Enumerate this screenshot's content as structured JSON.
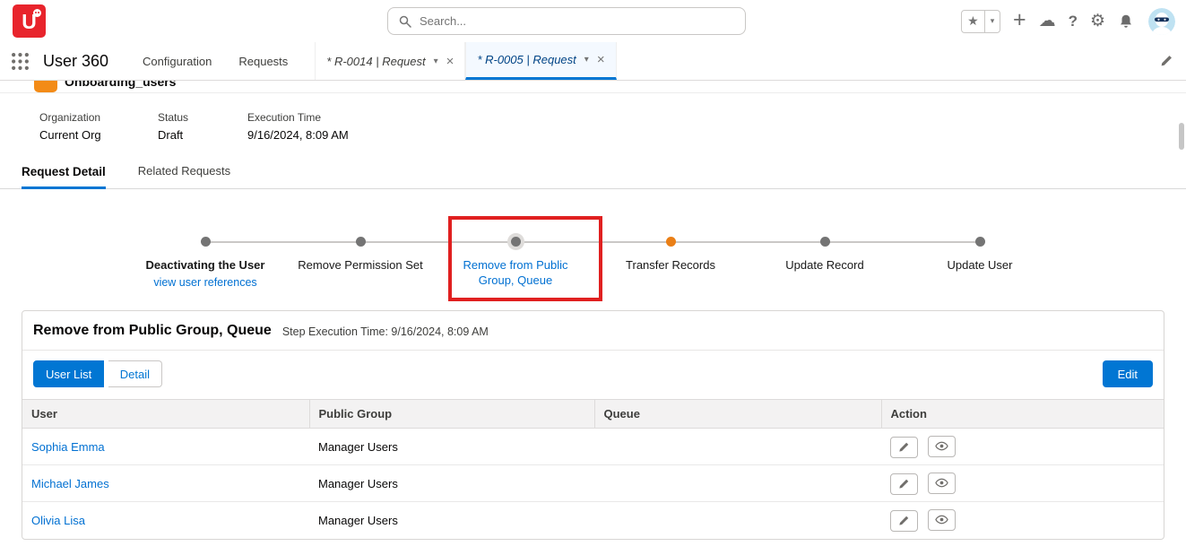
{
  "colors": {
    "brand_blue": "#0176d3",
    "link_blue": "#0070d2",
    "logo_red": "#e8242c",
    "path_current_orange": "#ea7f16",
    "annotation_red": "#e02020"
  },
  "glyphs": {
    "star": "★",
    "caret_down": "▾",
    "plus": "+",
    "cloud": "☁",
    "help": "?",
    "gear": "⚙",
    "chevron_down": "▾",
    "close": "×"
  },
  "header": {
    "logo_text": "U",
    "search_placeholder": "Search..."
  },
  "nav": {
    "app_name": "User 360",
    "items": [
      "Configuration",
      "Requests"
    ],
    "record_tabs": [
      {
        "label": "* R-0014 | Request",
        "active": false
      },
      {
        "label": "* R-0005 | Request",
        "active": true
      }
    ]
  },
  "record": {
    "title": "Onboarding_users",
    "fields": [
      {
        "label": "Organization",
        "value": "Current Org"
      },
      {
        "label": "Status",
        "value": "Draft"
      },
      {
        "label": "Execution Time",
        "value": "9/16/2024, 8:09 AM"
      }
    ],
    "tabs": [
      {
        "label": "Request Detail",
        "active": true
      },
      {
        "label": "Related Requests",
        "active": false
      }
    ]
  },
  "path": {
    "steps": [
      {
        "label": "Deactivating the User",
        "link": "view user references",
        "state": "completed"
      },
      {
        "label": "Remove Permission Set",
        "state": "completed"
      },
      {
        "label": "Remove from Public Group, Queue",
        "state": "selected"
      },
      {
        "label": "Transfer Records",
        "state": "current"
      },
      {
        "label": "Update Record",
        "state": "upcoming"
      },
      {
        "label": "Update User",
        "state": "upcoming"
      }
    ]
  },
  "section": {
    "title": "Remove from Public Group, Queue",
    "execution_label": "Step Execution Time: 9/16/2024, 8:09 AM",
    "toggle_buttons": [
      {
        "label": "User List",
        "active": true
      },
      {
        "label": "Detail",
        "active": false
      }
    ],
    "edit_button": "Edit"
  },
  "table": {
    "columns": [
      "User",
      "Public Group",
      "Queue",
      "Action"
    ],
    "rows": [
      {
        "user": "Sophia Emma",
        "public_group": "Manager Users",
        "queue": ""
      },
      {
        "user": "Michael James",
        "public_group": "Manager Users",
        "queue": ""
      },
      {
        "user": "Olivia Lisa",
        "public_group": "Manager Users",
        "queue": ""
      }
    ]
  }
}
